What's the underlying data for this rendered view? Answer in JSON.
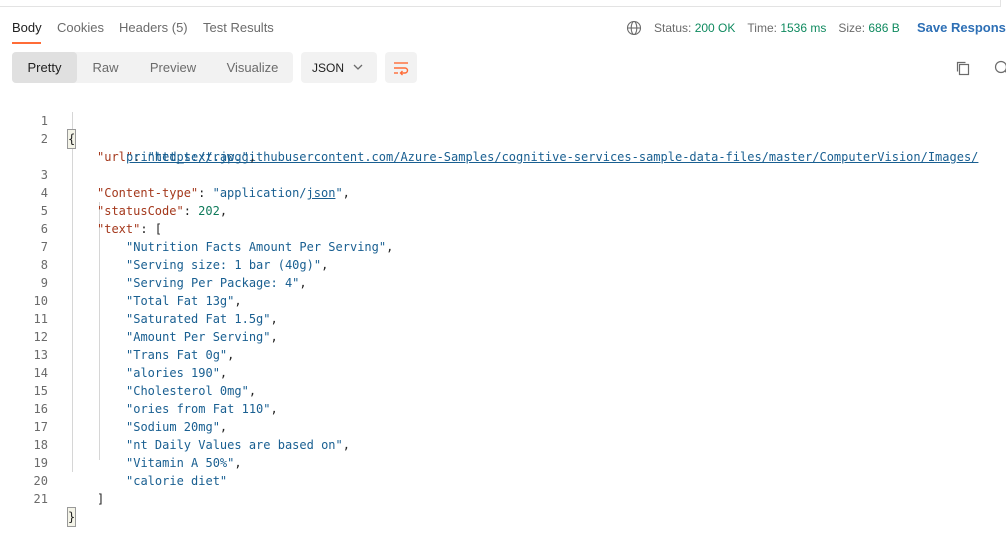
{
  "tabs": {
    "body": "Body",
    "cookies": "Cookies",
    "headers": "Headers (5)",
    "test_results": "Test Results"
  },
  "status": {
    "status_label": "Status:",
    "status_value": "200 OK",
    "time_label": "Time:",
    "time_value": "1536 ms",
    "size_label": "Size:",
    "size_value": "686 B"
  },
  "save_response": "Save Response",
  "view_modes": [
    "Pretty",
    "Raw",
    "Preview",
    "Visualize"
  ],
  "format": "JSON",
  "icons": {
    "globe": "globe-icon",
    "chevron": "chevron-down-icon",
    "wrap": "wrap-lines-icon",
    "copy": "copy-icon",
    "search": "search-icon"
  },
  "colors": {
    "accent": "#ff6c37",
    "status_ok": "#0f8a5f",
    "link": "#2d6fb5",
    "json_key": "#a4381c",
    "json_string": "#195f91",
    "json_number": "#0f7a5a"
  },
  "json": {
    "url_key": "\"url\"",
    "url_part1": "\"https://raw.githubusercontent.com/Azure-Samples/cognitive-services-sample-data-files/master/ComputerVision/Images/",
    "url_part2": "printed_text.jpg\"",
    "content_type_key": "\"Content-type\"",
    "content_type_a": "\"application/",
    "content_type_b": "json",
    "content_type_c": "\"",
    "status_code_key": "\"statusCode\"",
    "status_code_value": "202",
    "text_key": "\"text\"",
    "text_items": [
      "\"Nutrition Facts Amount Per Serving\"",
      "\"Serving size: 1 bar (40g)\"",
      "\"Serving Per Package: 4\"",
      "\"Total Fat 13g\"",
      "\"Saturated Fat 1.5g\"",
      "\"Amount Per Serving\"",
      "\"Trans Fat 0g\"",
      "\"alories 190\"",
      "\"Cholesterol 0mg\"",
      "\"ories from Fat 110\"",
      "\"Sodium 20mg\"",
      "\"nt Daily Values are based on\"",
      "\"Vitamin A 50%\"",
      "\"calorie diet\""
    ]
  },
  "line_numbers": [
    "1",
    "2",
    "3",
    "4",
    "5",
    "6",
    "7",
    "8",
    "9",
    "10",
    "11",
    "12",
    "13",
    "14",
    "15",
    "16",
    "17",
    "18",
    "19",
    "20",
    "21"
  ]
}
